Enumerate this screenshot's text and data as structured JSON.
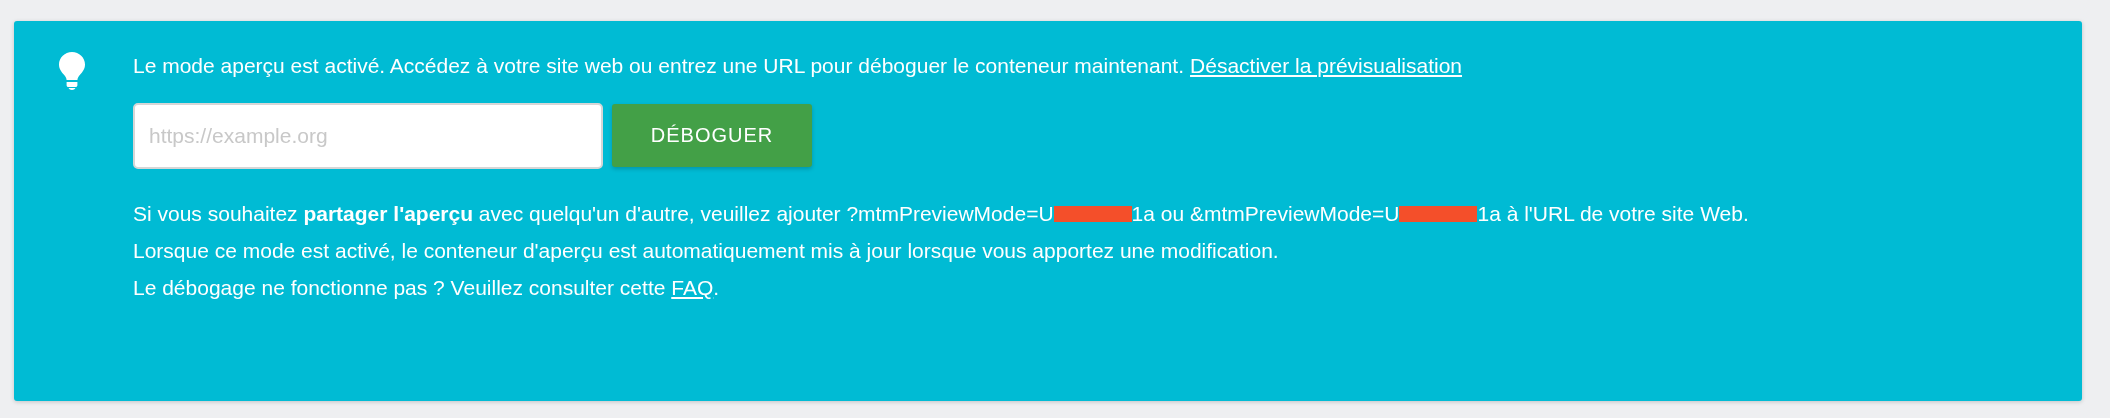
{
  "notice": {
    "message": "Le mode aperçu est activé. Accédez à votre site web ou entrez une URL pour déboguer le conteneur maintenant.",
    "link": "Désactiver la prévisualisation",
    "url_field": {
      "placeholder": "https://example.org"
    },
    "button": "DÉBOGUER",
    "share_note": [
      {
        "kind": "text",
        "text": "Si vous souhaitez **partager l'aperçu** avec quelqu'un d'autre, veuillez ajouter ?mtmPreviewMode=U"
      },
      {
        "kind": "redaction"
      },
      {
        "kind": "text",
        "text": "1a ou &mtmPreviewMode=U"
      },
      {
        "kind": "redaction"
      },
      {
        "kind": "text",
        "text": "1a à l'URL de votre site Web."
      }
    ],
    "auto_update": "Lorsque ce mode est activé, le conteneur d'aperçu est automatiquement mis à jour lorsque vous apportez une modification.",
    "faq_text": "Le débogage ne fonctionne pas ? Veuillez consulter cette",
    "faq_link": "FAQ",
    "faq_end": "."
  }
}
